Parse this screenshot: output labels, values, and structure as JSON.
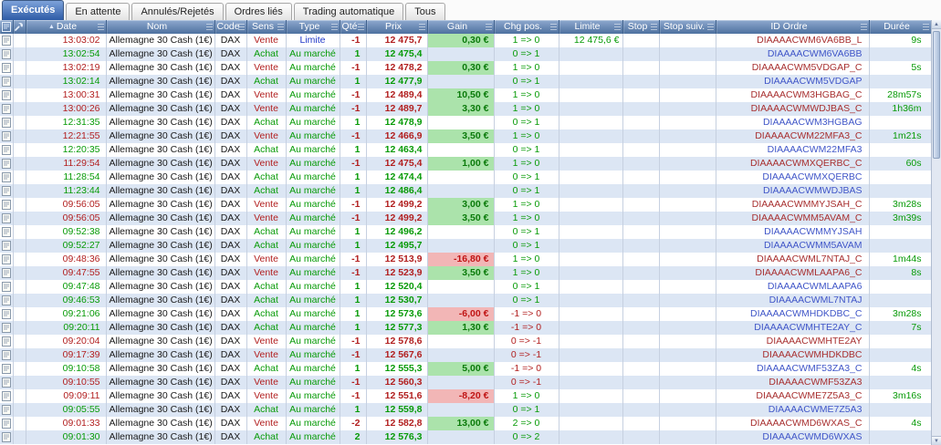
{
  "tabs": [
    {
      "slug": "executes",
      "label": "Exécutés",
      "active": true
    },
    {
      "slug": "en-attente",
      "label": "En attente",
      "active": false
    },
    {
      "slug": "annules-rejetes",
      "label": "Annulés/Rejetés",
      "active": false
    },
    {
      "slug": "ordres-lies",
      "label": "Ordres liés",
      "active": false
    },
    {
      "slug": "trading-automatique",
      "label": "Trading automatique",
      "active": false
    },
    {
      "slug": "tous",
      "label": "Tous",
      "active": false
    }
  ],
  "columns": [
    {
      "key": "details",
      "label": "",
      "icon": "doc"
    },
    {
      "key": "tools",
      "label": "",
      "icon": "wrench"
    },
    {
      "key": "date",
      "label": "Date",
      "sorted": true
    },
    {
      "key": "nom",
      "label": "Nom"
    },
    {
      "key": "code",
      "label": "Code"
    },
    {
      "key": "sens",
      "label": "Sens"
    },
    {
      "key": "type",
      "label": "Type"
    },
    {
      "key": "qte",
      "label": "Qté"
    },
    {
      "key": "prix",
      "label": "Prix"
    },
    {
      "key": "gain",
      "label": "Gain"
    },
    {
      "key": "chg",
      "label": "Chg pos."
    },
    {
      "key": "limite",
      "label": "Limite"
    },
    {
      "key": "stop",
      "label": "Stop"
    },
    {
      "key": "stop-suiv",
      "label": "Stop suiv."
    },
    {
      "key": "id",
      "label": "ID Ordre"
    },
    {
      "key": "duree",
      "label": "Durée"
    }
  ],
  "colors": {
    "header_blue": "#4e719f",
    "active_tab_blue": "#2e5ca6",
    "zebra_blue": "#dce6f4",
    "sell_red": "#b22020",
    "buy_green": "#089b08",
    "limit_blue": "#2038c8",
    "gain_pos_bg": "#abe3ab",
    "gain_neg_bg": "#f2b6b6",
    "id_blue": "#4056c8"
  },
  "table": {
    "rows": [
      {
        "date": "13:03:02",
        "nom": "Allemagne 30 Cash (1€)",
        "code": "DAX",
        "sens": "Vente",
        "type": "Limite",
        "qte": "-1",
        "prix": "12 475,7",
        "gain": "0,30 €",
        "chg": "1 => 0",
        "limite": "12 475,6 €",
        "stop": "",
        "stop_suiv": "",
        "id": "DIAAAACWM6VA6BB_L",
        "duree": "9s"
      },
      {
        "date": "13:02:54",
        "nom": "Allemagne 30 Cash (1€)",
        "code": "DAX",
        "sens": "Achat",
        "type": "Au marché",
        "qte": "1",
        "prix": "12 475,4",
        "gain": "",
        "chg": "0 => 1",
        "limite": "",
        "stop": "",
        "stop_suiv": "",
        "id": "DIAAAACWM6VA6BB",
        "duree": ""
      },
      {
        "date": "13:02:19",
        "nom": "Allemagne 30 Cash (1€)",
        "code": "DAX",
        "sens": "Vente",
        "type": "Au marché",
        "qte": "-1",
        "prix": "12 478,2",
        "gain": "0,30 €",
        "chg": "1 => 0",
        "limite": "",
        "stop": "",
        "stop_suiv": "",
        "id": "DIAAAACWM5VDGAP_C",
        "duree": "5s"
      },
      {
        "date": "13:02:14",
        "nom": "Allemagne 30 Cash (1€)",
        "code": "DAX",
        "sens": "Achat",
        "type": "Au marché",
        "qte": "1",
        "prix": "12 477,9",
        "gain": "",
        "chg": "0 => 1",
        "limite": "",
        "stop": "",
        "stop_suiv": "",
        "id": "DIAAAACWM5VDGAP",
        "duree": ""
      },
      {
        "date": "13:00:31",
        "nom": "Allemagne 30 Cash (1€)",
        "code": "DAX",
        "sens": "Vente",
        "type": "Au marché",
        "qte": "-1",
        "prix": "12 489,4",
        "gain": "10,50 €",
        "chg": "1 => 0",
        "limite": "",
        "stop": "",
        "stop_suiv": "",
        "id": "DIAAAACWM3HGBAG_C",
        "duree": "28m57s"
      },
      {
        "date": "13:00:26",
        "nom": "Allemagne 30 Cash (1€)",
        "code": "DAX",
        "sens": "Vente",
        "type": "Au marché",
        "qte": "-1",
        "prix": "12 489,7",
        "gain": "3,30 €",
        "chg": "1 => 0",
        "limite": "",
        "stop": "",
        "stop_suiv": "",
        "id": "DIAAAACWMWDJBAS_C",
        "duree": "1h36m"
      },
      {
        "date": "12:31:35",
        "nom": "Allemagne 30 Cash (1€)",
        "code": "DAX",
        "sens": "Achat",
        "type": "Au marché",
        "qte": "1",
        "prix": "12 478,9",
        "gain": "",
        "chg": "0 => 1",
        "limite": "",
        "stop": "",
        "stop_suiv": "",
        "id": "DIAAAACWM3HGBAG",
        "duree": ""
      },
      {
        "date": "12:21:55",
        "nom": "Allemagne 30 Cash (1€)",
        "code": "DAX",
        "sens": "Vente",
        "type": "Au marché",
        "qte": "-1",
        "prix": "12 466,9",
        "gain": "3,50 €",
        "chg": "1 => 0",
        "limite": "",
        "stop": "",
        "stop_suiv": "",
        "id": "DIAAAACWM22MFA3_C",
        "duree": "1m21s"
      },
      {
        "date": "12:20:35",
        "nom": "Allemagne 30 Cash (1€)",
        "code": "DAX",
        "sens": "Achat",
        "type": "Au marché",
        "qte": "1",
        "prix": "12 463,4",
        "gain": "",
        "chg": "0 => 1",
        "limite": "",
        "stop": "",
        "stop_suiv": "",
        "id": "DIAAAACWM22MFA3",
        "duree": ""
      },
      {
        "date": "11:29:54",
        "nom": "Allemagne 30 Cash (1€)",
        "code": "DAX",
        "sens": "Vente",
        "type": "Au marché",
        "qte": "-1",
        "prix": "12 475,4",
        "gain": "1,00 €",
        "chg": "1 => 0",
        "limite": "",
        "stop": "",
        "stop_suiv": "",
        "id": "DIAAAACWMXQERBC_C",
        "duree": "60s"
      },
      {
        "date": "11:28:54",
        "nom": "Allemagne 30 Cash (1€)",
        "code": "DAX",
        "sens": "Achat",
        "type": "Au marché",
        "qte": "1",
        "prix": "12 474,4",
        "gain": "",
        "chg": "0 => 1",
        "limite": "",
        "stop": "",
        "stop_suiv": "",
        "id": "DIAAAACWMXQERBC",
        "duree": ""
      },
      {
        "date": "11:23:44",
        "nom": "Allemagne 30 Cash (1€)",
        "code": "DAX",
        "sens": "Achat",
        "type": "Au marché",
        "qte": "1",
        "prix": "12 486,4",
        "gain": "",
        "chg": "0 => 1",
        "limite": "",
        "stop": "",
        "stop_suiv": "",
        "id": "DIAAAACWMWDJBAS",
        "duree": ""
      },
      {
        "date": "09:56:05",
        "nom": "Allemagne 30 Cash (1€)",
        "code": "DAX",
        "sens": "Vente",
        "type": "Au marché",
        "qte": "-1",
        "prix": "12 499,2",
        "gain": "3,00 €",
        "chg": "1 => 0",
        "limite": "",
        "stop": "",
        "stop_suiv": "",
        "id": "DIAAAACWMMYJSAH_C",
        "duree": "3m28s"
      },
      {
        "date": "09:56:05",
        "nom": "Allemagne 30 Cash (1€)",
        "code": "DAX",
        "sens": "Vente",
        "type": "Au marché",
        "qte": "-1",
        "prix": "12 499,2",
        "gain": "3,50 €",
        "chg": "1 => 0",
        "limite": "",
        "stop": "",
        "stop_suiv": "",
        "id": "DIAAAACWMM5AVAM_C",
        "duree": "3m39s"
      },
      {
        "date": "09:52:38",
        "nom": "Allemagne 30 Cash (1€)",
        "code": "DAX",
        "sens": "Achat",
        "type": "Au marché",
        "qte": "1",
        "prix": "12 496,2",
        "gain": "",
        "chg": "0 => 1",
        "limite": "",
        "stop": "",
        "stop_suiv": "",
        "id": "DIAAAACWMMYJSAH",
        "duree": ""
      },
      {
        "date": "09:52:27",
        "nom": "Allemagne 30 Cash (1€)",
        "code": "DAX",
        "sens": "Achat",
        "type": "Au marché",
        "qte": "1",
        "prix": "12 495,7",
        "gain": "",
        "chg": "0 => 1",
        "limite": "",
        "stop": "",
        "stop_suiv": "",
        "id": "DIAAAACWMM5AVAM",
        "duree": ""
      },
      {
        "date": "09:48:36",
        "nom": "Allemagne 30 Cash (1€)",
        "code": "DAX",
        "sens": "Vente",
        "type": "Au marché",
        "qte": "-1",
        "prix": "12 513,9",
        "gain": "-16,80 €",
        "chg": "1 => 0",
        "limite": "",
        "stop": "",
        "stop_suiv": "",
        "id": "DIAAAACWML7NTAJ_C",
        "duree": "1m44s"
      },
      {
        "date": "09:47:55",
        "nom": "Allemagne 30 Cash (1€)",
        "code": "DAX",
        "sens": "Vente",
        "type": "Au marché",
        "qte": "-1",
        "prix": "12 523,9",
        "gain": "3,50 €",
        "chg": "1 => 0",
        "limite": "",
        "stop": "",
        "stop_suiv": "",
        "id": "DIAAAACWMLAAPA6_C",
        "duree": "8s"
      },
      {
        "date": "09:47:48",
        "nom": "Allemagne 30 Cash (1€)",
        "code": "DAX",
        "sens": "Achat",
        "type": "Au marché",
        "qte": "1",
        "prix": "12 520,4",
        "gain": "",
        "chg": "0 => 1",
        "limite": "",
        "stop": "",
        "stop_suiv": "",
        "id": "DIAAAACWMLAAPA6",
        "duree": ""
      },
      {
        "date": "09:46:53",
        "nom": "Allemagne 30 Cash (1€)",
        "code": "DAX",
        "sens": "Achat",
        "type": "Au marché",
        "qte": "1",
        "prix": "12 530,7",
        "gain": "",
        "chg": "0 => 1",
        "limite": "",
        "stop": "",
        "stop_suiv": "",
        "id": "DIAAAACWML7NTAJ",
        "duree": ""
      },
      {
        "date": "09:21:06",
        "nom": "Allemagne 30 Cash (1€)",
        "code": "DAX",
        "sens": "Achat",
        "type": "Au marché",
        "qte": "1",
        "prix": "12 573,6",
        "gain": "-6,00 €",
        "chg": "-1 => 0",
        "limite": "",
        "stop": "",
        "stop_suiv": "",
        "id": "DIAAAACWMHDKDBC_C",
        "duree": "3m28s"
      },
      {
        "date": "09:20:11",
        "nom": "Allemagne 30 Cash (1€)",
        "code": "DAX",
        "sens": "Achat",
        "type": "Au marché",
        "qte": "1",
        "prix": "12 577,3",
        "gain": "1,30 €",
        "chg": "-1 => 0",
        "limite": "",
        "stop": "",
        "stop_suiv": "",
        "id": "DIAAAACWMHTE2AY_C",
        "duree": "7s"
      },
      {
        "date": "09:20:04",
        "nom": "Allemagne 30 Cash (1€)",
        "code": "DAX",
        "sens": "Vente",
        "type": "Au marché",
        "qte": "-1",
        "prix": "12 578,6",
        "gain": "",
        "chg": "0 => -1",
        "limite": "",
        "stop": "",
        "stop_suiv": "",
        "id": "DIAAAACWMHTE2AY",
        "duree": ""
      },
      {
        "date": "09:17:39",
        "nom": "Allemagne 30 Cash (1€)",
        "code": "DAX",
        "sens": "Vente",
        "type": "Au marché",
        "qte": "-1",
        "prix": "12 567,6",
        "gain": "",
        "chg": "0 => -1",
        "limite": "",
        "stop": "",
        "stop_suiv": "",
        "id": "DIAAAACWMHDKDBC",
        "duree": ""
      },
      {
        "date": "09:10:58",
        "nom": "Allemagne 30 Cash (1€)",
        "code": "DAX",
        "sens": "Achat",
        "type": "Au marché",
        "qte": "1",
        "prix": "12 555,3",
        "gain": "5,00 €",
        "chg": "-1 => 0",
        "limite": "",
        "stop": "",
        "stop_suiv": "",
        "id": "DIAAAACWMF53ZA3_C",
        "duree": "4s"
      },
      {
        "date": "09:10:55",
        "nom": "Allemagne 30 Cash (1€)",
        "code": "DAX",
        "sens": "Vente",
        "type": "Au marché",
        "qte": "-1",
        "prix": "12 560,3",
        "gain": "",
        "chg": "0 => -1",
        "limite": "",
        "stop": "",
        "stop_suiv": "",
        "id": "DIAAAACWMF53ZA3",
        "duree": ""
      },
      {
        "date": "09:09:11",
        "nom": "Allemagne 30 Cash (1€)",
        "code": "DAX",
        "sens": "Vente",
        "type": "Au marché",
        "qte": "-1",
        "prix": "12 551,6",
        "gain": "-8,20 €",
        "chg": "1 => 0",
        "limite": "",
        "stop": "",
        "stop_suiv": "",
        "id": "DIAAAACWME7Z5A3_C",
        "duree": "3m16s"
      },
      {
        "date": "09:05:55",
        "nom": "Allemagne 30 Cash (1€)",
        "code": "DAX",
        "sens": "Achat",
        "type": "Au marché",
        "qte": "1",
        "prix": "12 559,8",
        "gain": "",
        "chg": "0 => 1",
        "limite": "",
        "stop": "",
        "stop_suiv": "",
        "id": "DIAAAACWME7Z5A3",
        "duree": ""
      },
      {
        "date": "09:01:33",
        "nom": "Allemagne 30 Cash (1€)",
        "code": "DAX",
        "sens": "Vente",
        "type": "Au marché",
        "qte": "-2",
        "prix": "12 582,8",
        "gain": "13,00 €",
        "chg": "2 => 0",
        "limite": "",
        "stop": "",
        "stop_suiv": "",
        "id": "DIAAAACWMD6WXAS_C",
        "duree": "4s"
      },
      {
        "date": "09:01:30",
        "nom": "Allemagne 30 Cash (1€)",
        "code": "DAX",
        "sens": "Achat",
        "type": "Au marché",
        "qte": "2",
        "prix": "12 576,3",
        "gain": "",
        "chg": "0 => 2",
        "limite": "",
        "stop": "",
        "stop_suiv": "",
        "id": "DIAAAACWMD6WXAS",
        "duree": ""
      }
    ]
  }
}
